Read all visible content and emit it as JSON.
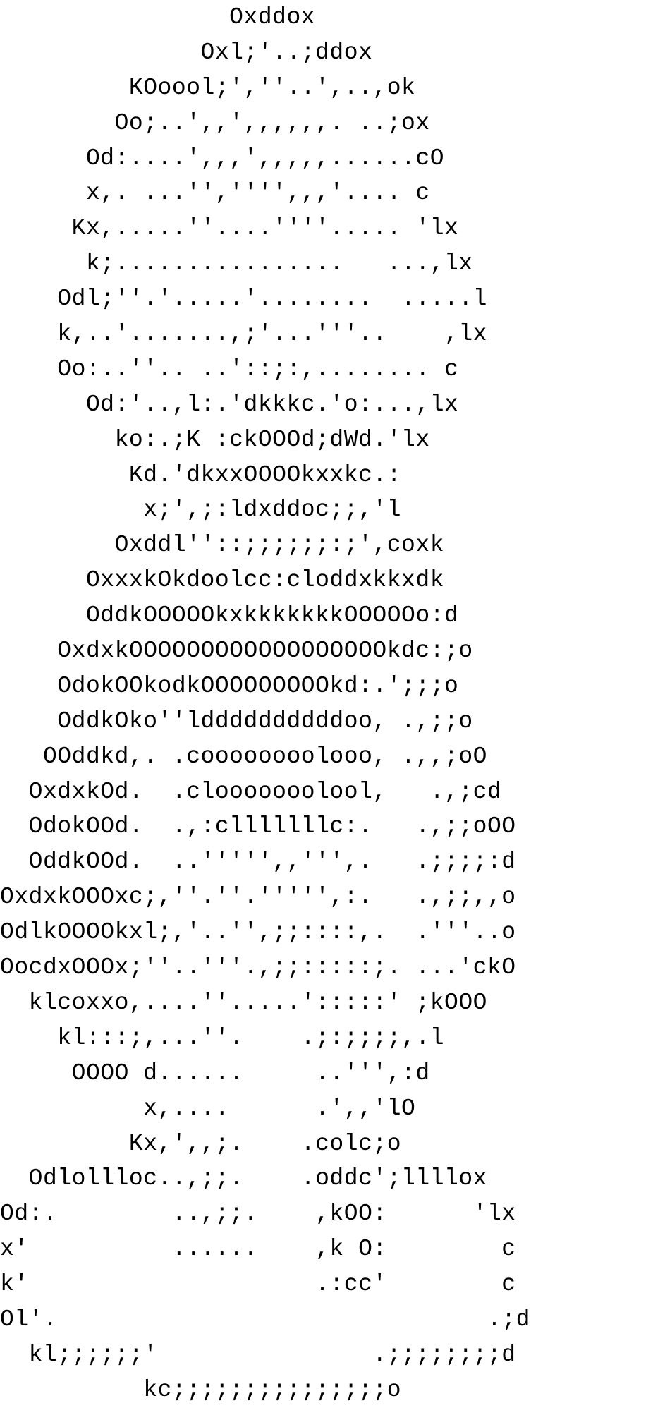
{
  "art": {
    "lines": [
      "                Oxddox",
      "              Oxl;'..;ddox",
      "         KOoool;',''..',..,ok",
      "        Oo;..',,',,,,,,. ..;ox",
      "      Od:....',,,',,,,,......cO",
      "      x,. ...'','''',,,'.... c",
      "     Kx,.....''....''''..... 'lx",
      "      k;................   ...,lx",
      "    Odl;''.'.....'........  .....l",
      "    k,..'.......,;'...'''..    ,lx",
      "    Oo:..''.. ..'::;:,........ c",
      "      Od:'..,l:.'dkkkc.'o:...,lx",
      "        ko:.;K :ckOOOd;dWd.'lx",
      "         Kd.'dkxxOOOOkxxkc.:",
      "          x;',;:ldxddoc;;,'l",
      "        Oxddl''::;;;;;;:;',coxk",
      "      OxxxkOkdoolcc:cloddxkkxdk",
      "      OddkOOOOOkxkkkkkkkOOOOOo:d",
      "    OxdxkOOOOOOOOOOOOOOOOOOkdc:;o",
      "    OdokOOkodkOOOOOOOOOkd:.';;;o",
      "    OddkOko''lddddddddddoo, .,;;o",
      "   OOddkd,. .coooooooolooo, .,,;oO",
      "  OxdxkOd.  .clooooooolool,   .,;cd",
      "  OdokOOd.  .,:clllllllc:.   .,;;oOO",
      "  OddkOOd.  ..''''',,''',.   .;;;;:d",
      "OxdxkOOOxc;,''.''.''''',:.   .,;;,,o",
      "OdlkOOOOkxl;,'..'',;;::::,.  .'''..o",
      "OocdxOOOx;''..'''.,;;:::::;. ...'ckO",
      "  klcoxxo,....''.....':::::' ;kOOO",
      "    kl:::;,...''.    .;:;;;;,.l",
      "     OOOO d......     ..''',:d",
      "          x,....      .',,'lO",
      "         Kx,',,;.    .colc;o",
      "  Odlollloc..,;;.    .oddc';llllox",
      "Od:.        ..,;;.    ,kOO:      'lx",
      "x'          ......    ,k O:        c",
      "k'                    .:cc'        c",
      "Ol'.                              .;d",
      "  kl;;;;;;'               .;;;;;;;;d",
      "          kc;;;;;;;;;;;;;;;o"
    ]
  }
}
